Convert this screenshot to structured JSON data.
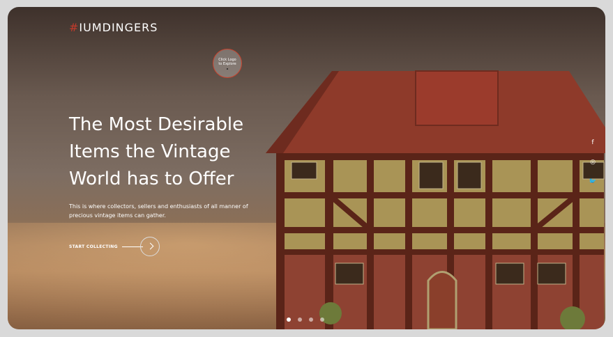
{
  "brand": {
    "hash": "#",
    "name": "IUMDINGERS"
  },
  "hint": {
    "line1": "Click Logo",
    "line2": "to Explore"
  },
  "hero": {
    "headline_1": "The Most Desirable",
    "headline_2": "Items the Vintage",
    "headline_3": "World has to Offer",
    "subtext": "This is where collectors, sellers and enthusiasts of all manner of precious vintage items can gather.",
    "cta_label": "START COLLECTING"
  },
  "social": {
    "icons": [
      "facebook-icon",
      "instagram-icon",
      "twitter-icon"
    ],
    "facebook": "f",
    "instagram": "◎",
    "twitter": "🐦"
  },
  "slider": {
    "count": 4,
    "active": 1
  },
  "colors": {
    "accent": "#c23a2b",
    "roof": "#8e3a2a",
    "timber": "#5a2418",
    "plaster": "#a99456"
  }
}
